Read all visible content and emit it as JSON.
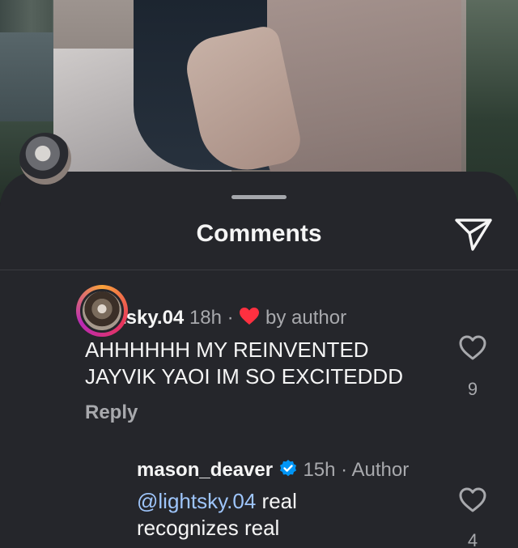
{
  "sheet": {
    "title": "Comments"
  },
  "comments": [
    {
      "username": "lightsky.04",
      "time": "18h",
      "separator": "·",
      "liked_by_author_label": "by author",
      "text": "AHHHHHH MY REINVENTED JAYVIK YAOI IM SO EXCITEDDD",
      "reply_label": "Reply",
      "likes": "9"
    },
    {
      "username": "mason_deaver",
      "time": "15h",
      "separator": "·",
      "role": "Author",
      "mention": "@lightsky.04",
      "text": " real recognizes real",
      "likes": "4"
    }
  ],
  "colors": {
    "sheet_background": "#25262b",
    "text_primary": "#f5f5f5",
    "text_secondary": "#a8a9ad",
    "mention": "#9ec5fb",
    "heart_red": "#ff3040",
    "verified_blue": "#0095f6"
  }
}
